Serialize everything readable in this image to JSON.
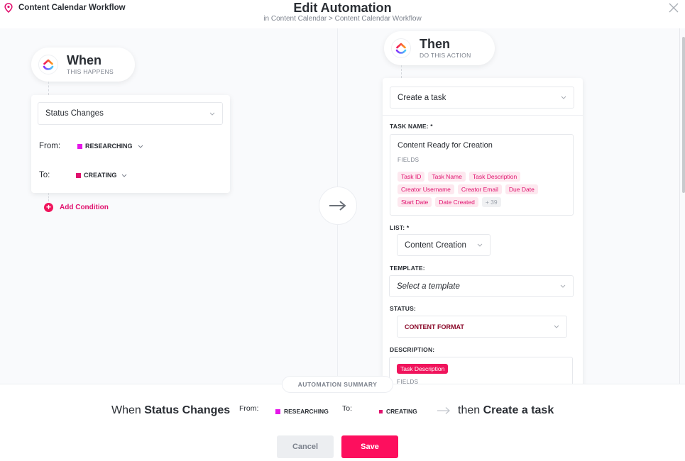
{
  "header": {
    "workflow_name": "Content Calendar Workflow",
    "title": "Edit Automation",
    "subtitle": "in Content Calendar > Content Calendar Workflow"
  },
  "when": {
    "title": "When",
    "subtitle": "THIS HAPPENS",
    "trigger": "Status Changes",
    "from_label": "From:",
    "from_status": {
      "name": "RESEARCHING",
      "color": "#e516e8"
    },
    "to_label": "To:",
    "to_status": {
      "name": "CREATING",
      "color": "#e0116e"
    },
    "add_condition": "Add Condition"
  },
  "then": {
    "title": "Then",
    "subtitle": "DO THIS ACTION",
    "action": "Create a task",
    "task_name_label": "TASK NAME: *",
    "task_name_value": "Content Ready for Creation",
    "fields_label": "FIELDS",
    "fields": [
      "Task ID",
      "Task Name",
      "Task Description",
      "Creator Username",
      "Creator Email",
      "Due Date",
      "Start Date",
      "Date Created"
    ],
    "fields_more": "+ 39",
    "list_label": "LIST: *",
    "list_value": "Content Creation",
    "template_label": "TEMPLATE:",
    "template_placeholder": "Select a template",
    "status_label": "STATUS:",
    "status_value": "CONTENT FORMAT",
    "description_label": "DESCRIPTION:",
    "description_chip": "Task Description",
    "description_fields_label": "FIELDS"
  },
  "summary": {
    "tab_label": "AUTOMATION SUMMARY",
    "when_word": "When",
    "trigger": "Status Changes",
    "from_label": "From:",
    "from_status": "RESEARCHING",
    "to_label": "To:",
    "to_status": "CREATING",
    "then_word": "then",
    "action": "Create a task"
  },
  "buttons": {
    "cancel": "Cancel",
    "save": "Save"
  },
  "colors": {
    "accent": "#fd0f5e",
    "researching": "#e516e8",
    "creating": "#e0116e",
    "content_format": "#8b0a2a"
  }
}
